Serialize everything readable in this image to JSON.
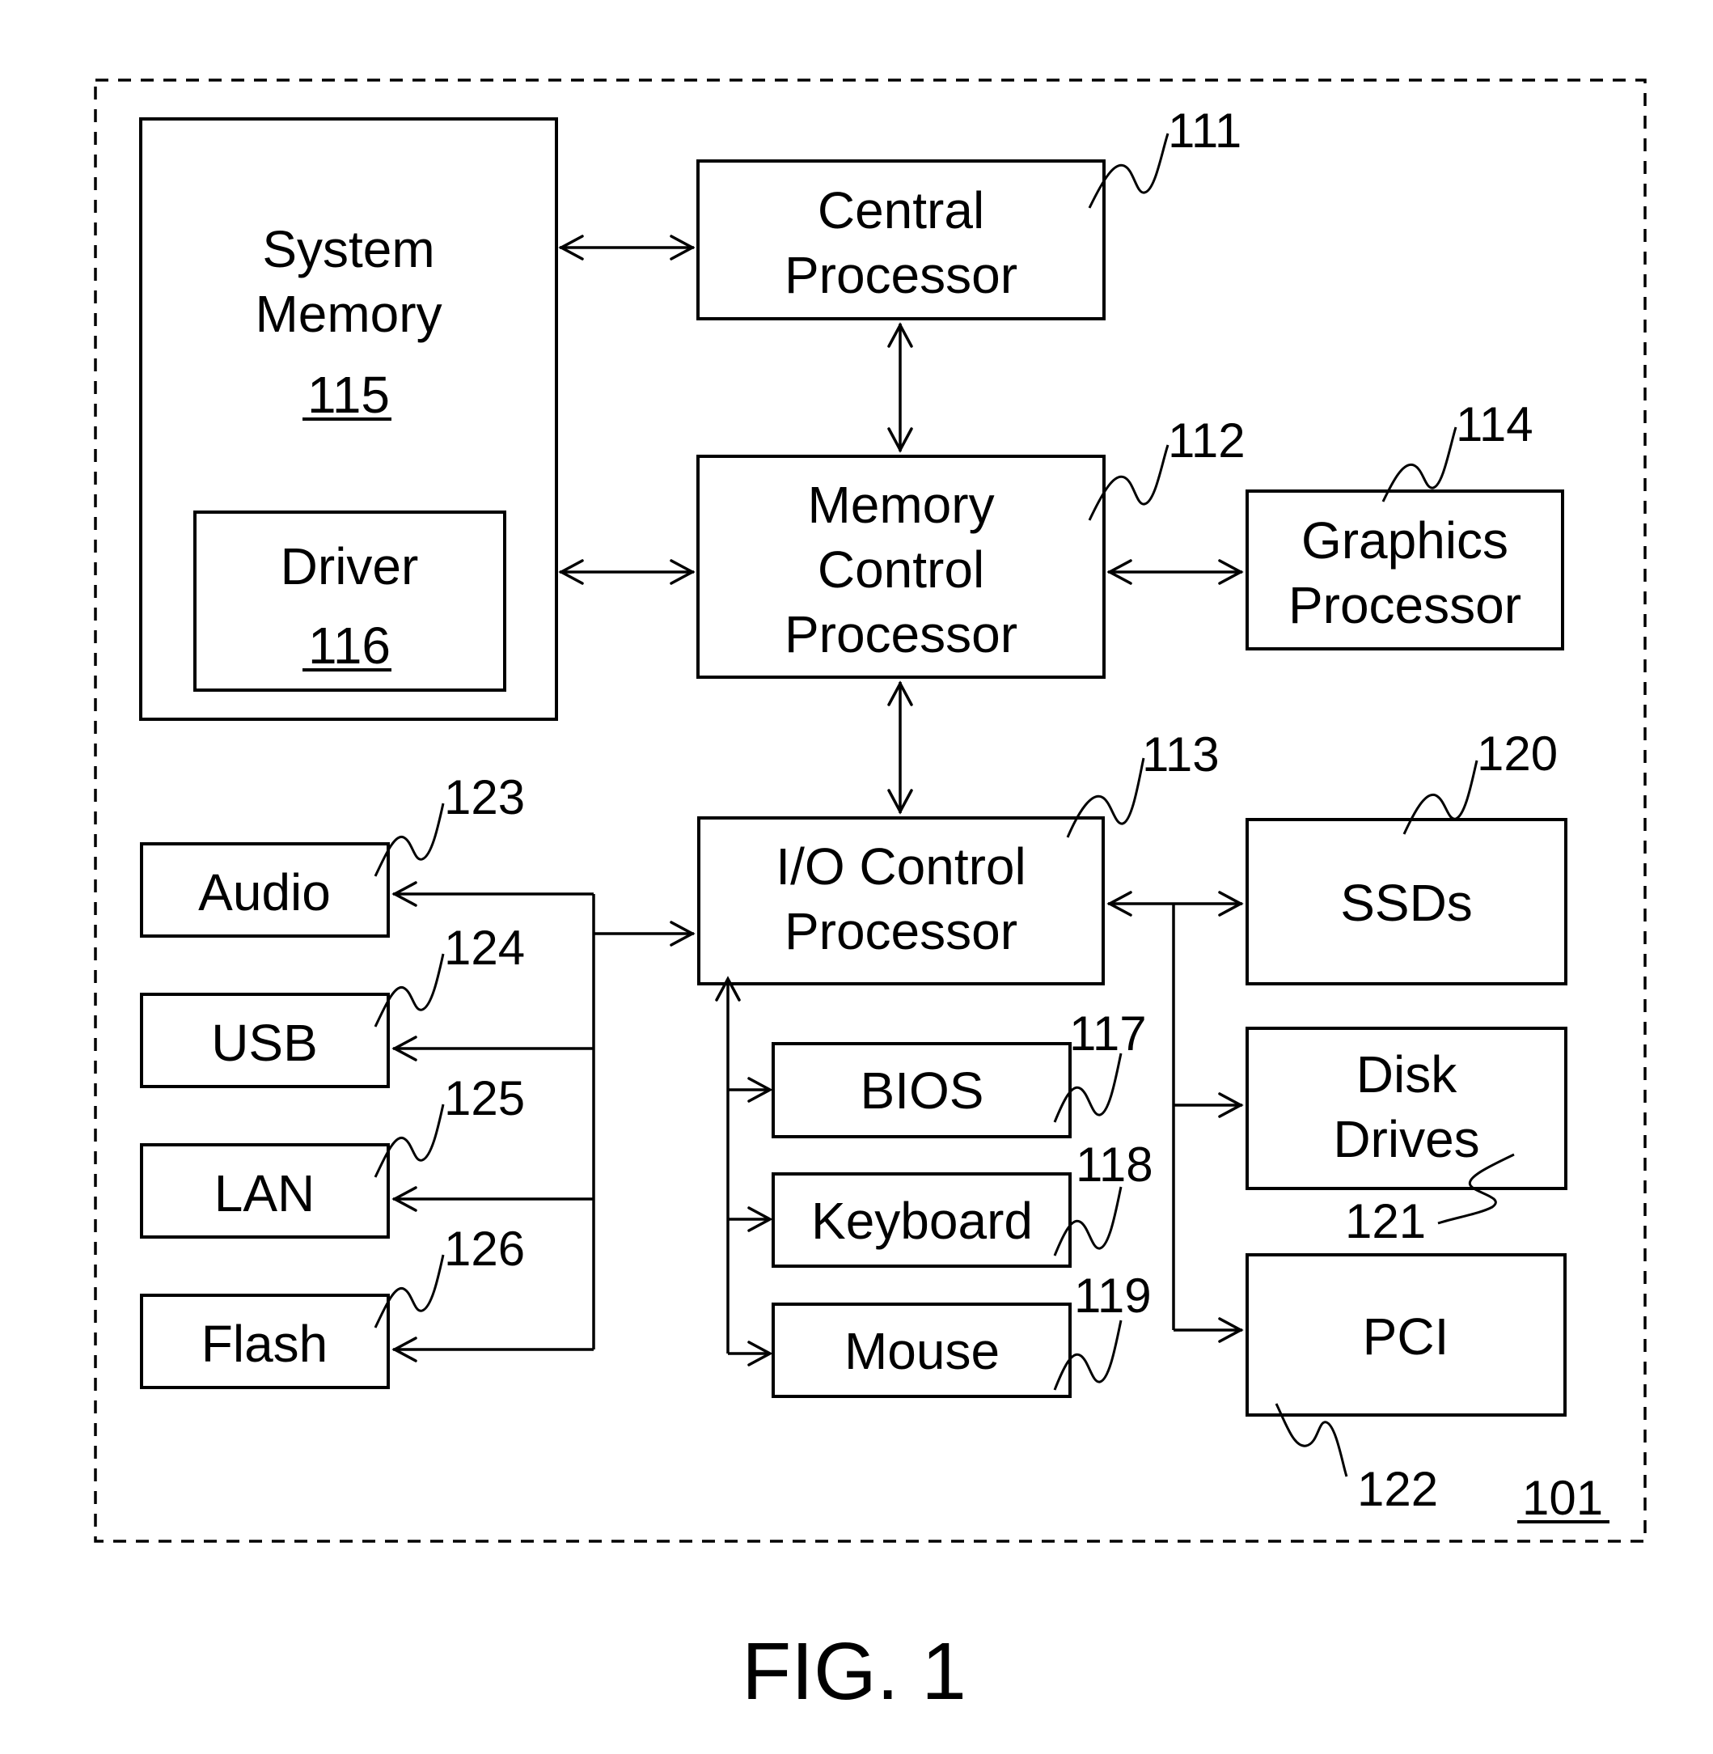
{
  "figure": {
    "caption": "FIG. 1",
    "system_ref": "101"
  },
  "components": {
    "system_memory": {
      "lines": [
        "System",
        "Memory"
      ],
      "ref": "115"
    },
    "driver": {
      "lines": [
        "Driver"
      ],
      "ref": "116"
    },
    "central_processor": {
      "lines": [
        "Central",
        "Processor"
      ],
      "ref": "111"
    },
    "memory_control_processor": {
      "lines": [
        "Memory",
        "Control",
        "Processor"
      ],
      "ref": "112"
    },
    "io_control_processor": {
      "lines": [
        "I/O Control",
        "Processor"
      ],
      "ref": "113"
    },
    "graphics_processor": {
      "lines": [
        "Graphics",
        "Processor"
      ],
      "ref": "114"
    },
    "bios": {
      "lines": [
        "BIOS"
      ],
      "ref": "117"
    },
    "keyboard": {
      "lines": [
        "Keyboard"
      ],
      "ref": "118"
    },
    "mouse": {
      "lines": [
        "Mouse"
      ],
      "ref": "119"
    },
    "ssds": {
      "lines": [
        "SSDs"
      ],
      "ref": "120"
    },
    "disk_drives": {
      "lines": [
        "Disk",
        "Drives"
      ],
      "ref": "121"
    },
    "pci": {
      "lines": [
        "PCI"
      ],
      "ref": "122"
    },
    "audio": {
      "lines": [
        "Audio"
      ],
      "ref": "123"
    },
    "usb": {
      "lines": [
        "USB"
      ],
      "ref": "124"
    },
    "lan": {
      "lines": [
        "LAN"
      ],
      "ref": "125"
    },
    "flash": {
      "lines": [
        "Flash"
      ],
      "ref": "126"
    }
  },
  "connections": [
    {
      "from": "system_memory",
      "to": "central_processor",
      "direction": "bidirectional"
    },
    {
      "from": "system_memory",
      "to": "memory_control_processor",
      "direction": "bidirectional"
    },
    {
      "from": "central_processor",
      "to": "memory_control_processor",
      "direction": "bidirectional"
    },
    {
      "from": "memory_control_processor",
      "to": "graphics_processor",
      "direction": "bidirectional"
    },
    {
      "from": "memory_control_processor",
      "to": "io_control_processor",
      "direction": "bidirectional"
    },
    {
      "from": "io_control_processor",
      "to": "ssds",
      "direction": "bidirectional"
    },
    {
      "from": "io_control_processor",
      "to": "disk_drives",
      "direction": "to"
    },
    {
      "from": "io_control_processor",
      "to": "pci",
      "direction": "to"
    },
    {
      "from": "io_control_processor",
      "to": "bios",
      "direction": "to"
    },
    {
      "from": "io_control_processor",
      "to": "keyboard",
      "direction": "to"
    },
    {
      "from": "io_control_processor",
      "to": "mouse",
      "direction": "to"
    },
    {
      "from": "io_control_processor",
      "to": "audio",
      "direction": "to"
    },
    {
      "from": "io_control_processor",
      "to": "usb",
      "direction": "to"
    },
    {
      "from": "io_control_processor",
      "to": "lan",
      "direction": "to"
    },
    {
      "from": "io_control_processor",
      "to": "flash",
      "direction": "to"
    }
  ]
}
